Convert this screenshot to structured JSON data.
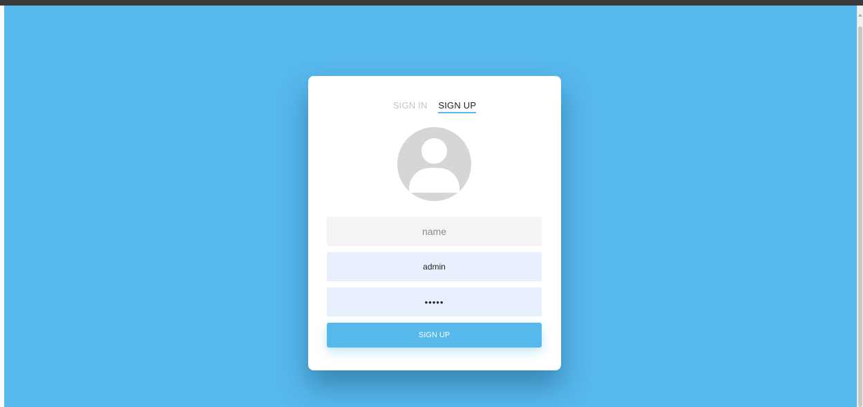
{
  "colors": {
    "background": "#57b8ec",
    "accent": "#57b8ec",
    "card": "#ffffff",
    "autofill_field": "#e8f0fd"
  },
  "tabs": {
    "sign_in": "SIGN IN",
    "sign_up": "SIGN UP",
    "active": "sign_up"
  },
  "avatar": {
    "icon": "user-avatar-icon"
  },
  "form": {
    "name": {
      "placeholder": "name",
      "value": ""
    },
    "username": {
      "value": "admin"
    },
    "password": {
      "value": "•••••"
    },
    "submit_label": "SIGN UP"
  }
}
